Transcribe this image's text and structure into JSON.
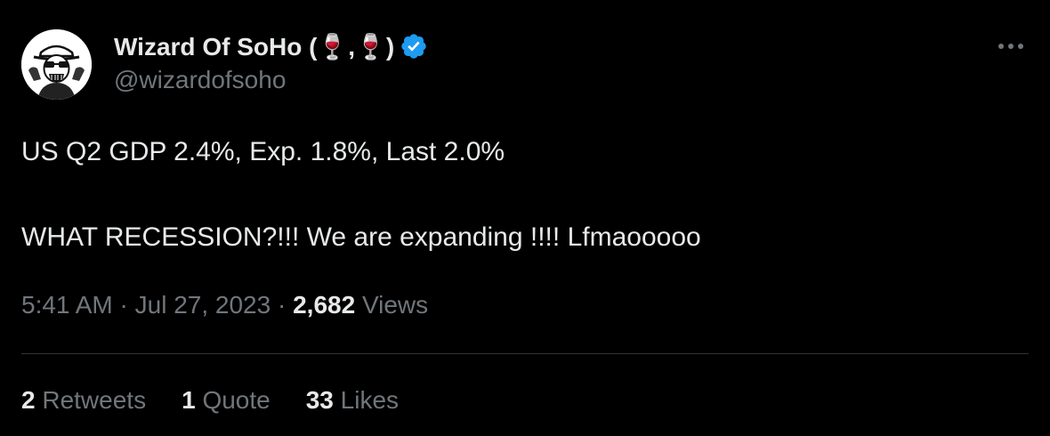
{
  "author": {
    "display_name": "Wizard Of SoHo (🍷,🍷)",
    "handle": "@wizardofsoho",
    "verified": true
  },
  "tweet": {
    "line1": "US Q2 GDP 2.4%, Exp. 1.8%, Last 2.0%",
    "line2": "WHAT RECESSION?!!! We are expanding !!!! Lfmaooooo"
  },
  "meta": {
    "time": "5:41 AM",
    "separator": "·",
    "date": "Jul 27, 2023",
    "views_count": "2,682",
    "views_label": "Views"
  },
  "stats": {
    "retweets_count": "2",
    "retweets_label": "Retweets",
    "quotes_count": "1",
    "quotes_label": "Quote",
    "likes_count": "33",
    "likes_label": "Likes"
  },
  "icons": {
    "verified": "verified-badge-icon",
    "more": "more-options-icon"
  },
  "colors": {
    "background": "#000000",
    "primary_text": "#e7e9ea",
    "secondary_text": "#71767b",
    "verified_blue": "#1d9bf0",
    "divider": "#2f3336"
  }
}
